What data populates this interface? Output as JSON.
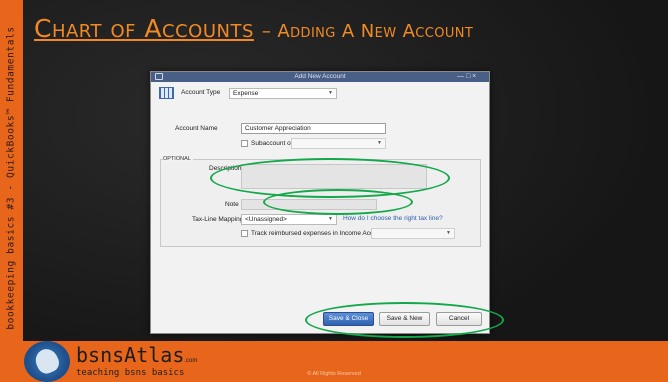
{
  "slide": {
    "title_main": "Chart of Accounts",
    "title_sub": "– Adding A New Account",
    "side_text": "bookkeeping basics #3 - QuickBooks™ Fundamentals"
  },
  "dialog": {
    "window_title": "Add New Account",
    "window_controls": "— □ ×",
    "account_type_label": "Account Type",
    "account_type_value": "Expense",
    "account_name_label": "Account Name",
    "account_name_value": "Customer Appreciation",
    "subaccount_label": "Subaccount of",
    "optional_label": "OPTIONAL",
    "description_label": "Description",
    "note_label": "Note",
    "tax_line_label": "Tax-Line Mapping",
    "tax_line_value": "<Unassigned>",
    "tax_help_link": "How do I choose the right tax line?",
    "track_reimbursed_label": "Track reimbursed expenses in Income Acct.",
    "buttons": {
      "save_close": "Save & Close",
      "save_new": "Save & New",
      "cancel": "Cancel"
    }
  },
  "footer": {
    "brand": "bsnsAtlas",
    "brand_suffix": ".com",
    "tagline": "teaching bsns basics",
    "copyright": "© All Rights Reserved"
  },
  "colors": {
    "accent_orange": "#e8661c",
    "title_orange": "#f28a24",
    "highlight_green": "#13a84a",
    "primary_button_blue": "#2f63b3"
  }
}
